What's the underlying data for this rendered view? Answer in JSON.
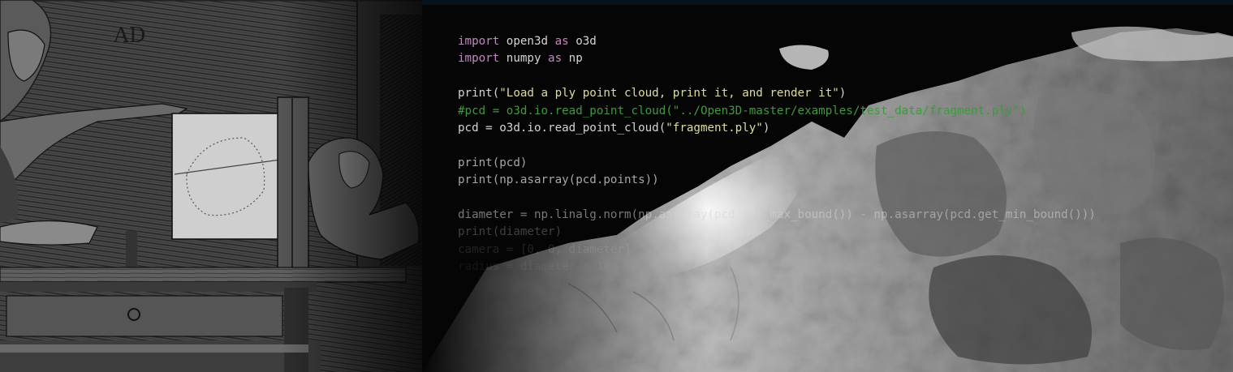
{
  "code": {
    "line1": {
      "kw1": "import",
      "rest": " open3d ",
      "kw2": "as",
      "rest2": " o3d"
    },
    "line2": {
      "kw1": "import",
      "rest": " numpy ",
      "kw2": "as",
      "rest2": " np"
    },
    "line3": {
      "fn": "print(",
      "str": "\"Load a ply point cloud, print it, and render it\"",
      "end": ")"
    },
    "line4": {
      "comment": "#pcd = o3d.io.read_point_cloud(\"../Open3D-master/examples/test_data/fragment.ply\")"
    },
    "line5": {
      "pre": "pcd = o3d.io.read_point_cloud(",
      "str": "\"fragment.ply\"",
      "end": ")"
    },
    "line6": "print(pcd)",
    "line7": "print(np.asarray(pcd.points))",
    "line8": "diameter = np.linalg.norm(np.asarray(pcd.get_max_bound()) - np.asarray(pcd.get_min_bound()))",
    "line9": "print(diameter)",
    "line10": "camera = [0, 0, diameter]",
    "line11": "radius = diameter * 100"
  },
  "engraving": {
    "monogram": "AD"
  },
  "colors": {
    "background": "#050505",
    "code_text": "#d4d4d4",
    "keyword": "#c586c0",
    "string": "#dcdca0",
    "comment": "#3f9a3f"
  }
}
